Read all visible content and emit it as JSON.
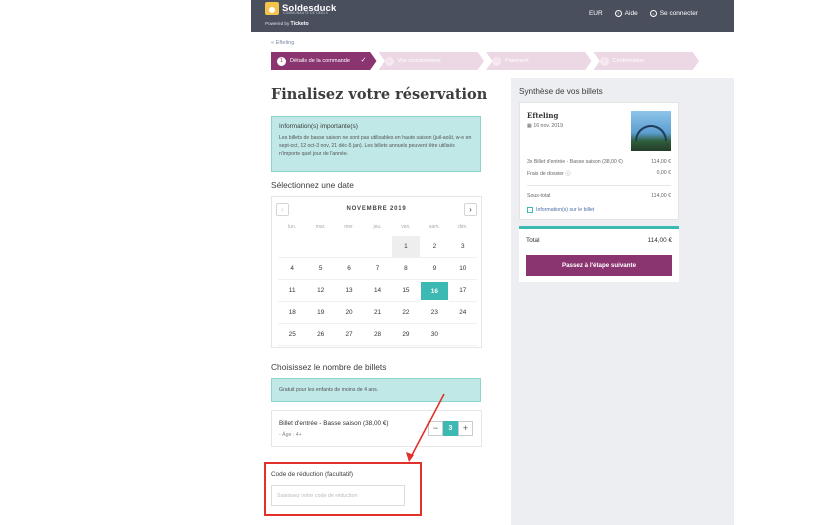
{
  "brand": {
    "name": "Soldesduck",
    "tagline": "COMMUNAUTÉ DE DEALS",
    "powered_by": "Powered by",
    "powered_brand": "Ticketo",
    "logo_color": "#f3c34a"
  },
  "topnav": {
    "currency": "EUR",
    "help": "Aide",
    "login": "Se connecter"
  },
  "breadcrumb": {
    "back": "« Efteling"
  },
  "steps": [
    {
      "num": "1",
      "label": "Détails de la commande",
      "active": true
    },
    {
      "num": "2",
      "label": "Vos coordonnées",
      "active": false
    },
    {
      "num": "3",
      "label": "Paiement",
      "active": false
    },
    {
      "num": "4",
      "label": "Confirmation",
      "active": false
    }
  ],
  "main": {
    "title": "Finalisez votre réservation",
    "info_title": "Information(s) importante(s)",
    "info_text": "Les billets de basse saison ne sont pas utilisables en haute saison (juil-août, w-e en sept-oct, 12 oct-3 nov, 21 déc-5 jan). Les billets annuels peuvent être utilisés n'importe quel jour de l'année.",
    "select_date_label": "Sélectionnez une date",
    "tickets_label": "Choisissez le nombre de billets",
    "children_notice": "Gratuit pour les enfants de moins de 4 ans.",
    "promo_label": "Code de réduction (facultatif)",
    "promo_placeholder": "Saisissez votre code de réduction"
  },
  "calendar": {
    "month": "NOVEMBRE 2019",
    "weekdays": [
      "lun.",
      "mar.",
      "mer.",
      "jeu.",
      "ven.",
      "sam.",
      "dim."
    ],
    "days": [
      {
        "d": "",
        "s": "empty"
      },
      {
        "d": "",
        "s": "empty"
      },
      {
        "d": "",
        "s": "empty"
      },
      {
        "d": "",
        "s": "empty"
      },
      {
        "d": "1",
        "s": "grey"
      },
      {
        "d": "2",
        "s": "normal"
      },
      {
        "d": "3",
        "s": "normal"
      },
      {
        "d": "4",
        "s": "normal"
      },
      {
        "d": "5",
        "s": "normal"
      },
      {
        "d": "6",
        "s": "normal"
      },
      {
        "d": "7",
        "s": "normal"
      },
      {
        "d": "8",
        "s": "normal"
      },
      {
        "d": "9",
        "s": "normal"
      },
      {
        "d": "10",
        "s": "normal"
      },
      {
        "d": "11",
        "s": "normal"
      },
      {
        "d": "12",
        "s": "normal"
      },
      {
        "d": "13",
        "s": "normal"
      },
      {
        "d": "14",
        "s": "normal"
      },
      {
        "d": "15",
        "s": "normal"
      },
      {
        "d": "16",
        "s": "selected"
      },
      {
        "d": "17",
        "s": "normal"
      },
      {
        "d": "18",
        "s": "normal"
      },
      {
        "d": "19",
        "s": "normal"
      },
      {
        "d": "20",
        "s": "normal"
      },
      {
        "d": "21",
        "s": "normal"
      },
      {
        "d": "22",
        "s": "normal"
      },
      {
        "d": "23",
        "s": "normal"
      },
      {
        "d": "24",
        "s": "normal"
      },
      {
        "d": "25",
        "s": "normal"
      },
      {
        "d": "26",
        "s": "normal"
      },
      {
        "d": "27",
        "s": "normal"
      },
      {
        "d": "28",
        "s": "normal"
      },
      {
        "d": "29",
        "s": "normal"
      },
      {
        "d": "30",
        "s": "normal"
      },
      {
        "d": "",
        "s": "empty"
      }
    ]
  },
  "ticket": {
    "name": "Billet d'entrée - Basse saison (38,00 €)",
    "age": "- Âge : 4+",
    "quantity": "3",
    "minus": "−",
    "plus": "+"
  },
  "summary": {
    "title": "Synthèse de vos billets",
    "park": "Efteling",
    "date": "16 nov. 2019",
    "line1_label": "3x Billet d'entrée - Basse saison (38,00 €)",
    "line1_value": "114,00 €",
    "line2_label": "Frais de dossier",
    "line2_value": "0,00 €",
    "subtotal_label": "Sous-total",
    "subtotal_value": "114,00 €",
    "info_link": "Information(s) sur le billet",
    "total_label": "Total",
    "total_value": "114,00 €",
    "next_button": "Passez à l'étape suivante"
  },
  "colors": {
    "primary": "#8b3570",
    "accent": "#3bb9b2",
    "topbar": "#4a4f5e",
    "annotation": "#e0312b"
  }
}
